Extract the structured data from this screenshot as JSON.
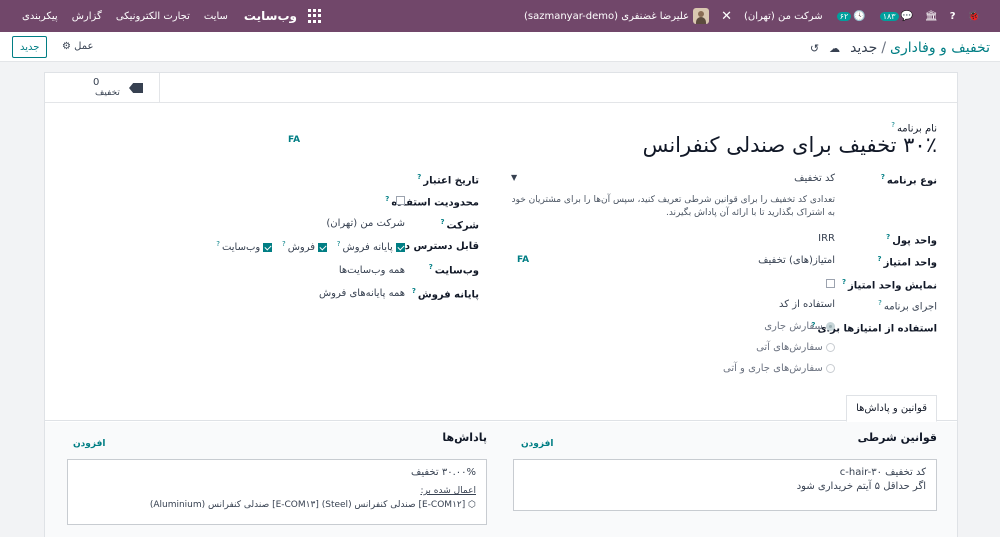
{
  "navbar": {
    "brand": "وب‌سایت",
    "menu": [
      "سایت",
      "تجارت الکترونیکی",
      "گزارش",
      "پیکربندی"
    ],
    "user": "علیرضا غضنفری (sazmanyar-demo)",
    "company": "شرکت من (تهران)",
    "messages_count": "۱۸۳",
    "activity_count": "۶۲"
  },
  "control": {
    "breadcrumb_parent": "تخفیف و وفاداری",
    "breadcrumb_current": "جدید",
    "new_button": "جدید",
    "action_button": "عمل"
  },
  "stat": {
    "count": "0",
    "label": "تخفیف"
  },
  "program": {
    "name_label": "نام برنامه",
    "name": "۳۰٪ تخفیف برای صندلی کنفرانس",
    "lang": "FA"
  },
  "left_fields": {
    "type_label": "نوع برنامه",
    "type_value": "کد تخفیف",
    "type_help": "تعدادی کد تخفیف را برای قوانین شرطی تعریف کنید، سپس آن‌ها را برای مشتریان خود به اشتراک بگذارید تا با ارائه آن پاداش بگیرند.",
    "currency_label": "واحد پول",
    "currency_value": "IRR",
    "points_unit_label": "واحد امتیاز",
    "points_unit_value": "امتیاز(های) تخفیف",
    "points_unit_lang": "FA",
    "show_points_label": "نمایش واحد امتیاز",
    "trigger_label": "اجرای برنامه",
    "trigger_value": "استفاده از کد",
    "apply_label": "استفاده از امتیازها برای",
    "apply_options": [
      "سفارش جاری",
      "سفارش‌های آتی",
      "سفارش‌های جاری و آتی"
    ]
  },
  "right_fields": {
    "validity_label": "تاریخ اعتبار",
    "limit_label": "محدودیت استفاده",
    "company_label": "شرکت",
    "company_value": "شرکت من (تهران)",
    "available_label": "قابل دسترس در",
    "available_options": [
      "پایانه فروش",
      "فروش",
      "وب‌سایت"
    ],
    "website_label": "وب‌سایت",
    "website_value": "همه وب‌سایت‌ها",
    "pos_label": "پایانه فروش",
    "pos_value": "همه پایانه‌های فروش"
  },
  "tabs": {
    "rules_tab": "قوانین و پاداش‌ها"
  },
  "rules": {
    "title": "قوانین شرطی",
    "add": "افزودن",
    "line1": "کد تخفیف c-hair-۳۰",
    "line2": "اگر حداقل ۵ آیتم خریداری شود"
  },
  "rewards": {
    "title": "پاداش‌ها",
    "add": "افزودن",
    "line1": "۳۰.۰۰% تخفیف",
    "applied_label": "اعمال شده بر:",
    "products": "[E-COM۱۲] صندلی کنفرانس (Steel)   [E-COM۱۳] صندلی کنفرانس (Aluminium)"
  }
}
